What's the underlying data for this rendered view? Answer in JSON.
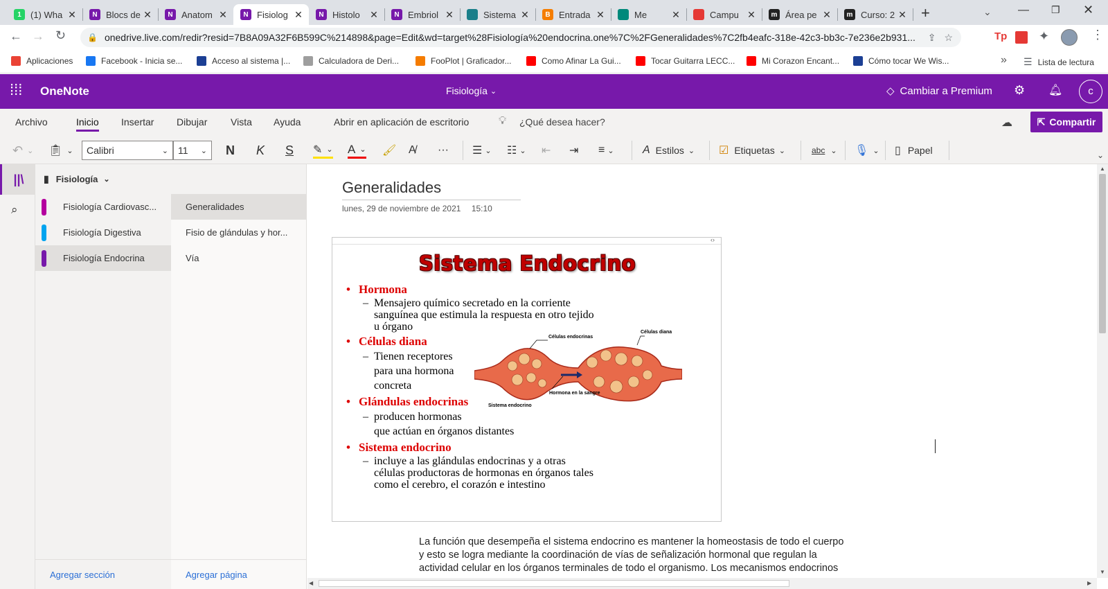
{
  "browser": {
    "tabs": [
      {
        "title": "(1) Wha",
        "icon": "whatsapp-icon",
        "color": "#25d366",
        "glyph": "1"
      },
      {
        "title": "Blocs de",
        "icon": "onenote-icon",
        "color": "#7719aa",
        "glyph": "N"
      },
      {
        "title": "Anatom",
        "icon": "onenote-icon",
        "color": "#7719aa",
        "glyph": "N"
      },
      {
        "title": "Fisiolog",
        "icon": "onenote-icon",
        "color": "#7719aa",
        "glyph": "N"
      },
      {
        "title": "Histolo",
        "icon": "onenote-icon",
        "color": "#7719aa",
        "glyph": "N"
      },
      {
        "title": "Embriol",
        "icon": "onenote-icon",
        "color": "#7719aa",
        "glyph": "N"
      },
      {
        "title": "Sistema",
        "icon": "slide-icon",
        "color": "#1a7f8a",
        "glyph": ""
      },
      {
        "title": "Entrada",
        "icon": "blogger-icon",
        "color": "#f57d00",
        "glyph": "B"
      },
      {
        "title": "Me",
        "icon": "meet-icon",
        "color": "#00897b",
        "glyph": ""
      },
      {
        "title": "Campu",
        "icon": "campus-icon",
        "color": "#e53935",
        "glyph": ""
      },
      {
        "title": "Área pe",
        "icon": "moodle-icon",
        "color": "#222222",
        "glyph": "m"
      },
      {
        "title": "Curso: 2",
        "icon": "moodle-icon",
        "color": "#222222",
        "glyph": "m"
      }
    ],
    "new_tab": "+",
    "url": "onedrive.live.com/redir?resid=7B8A09A32F6B599C%214898&page=Edit&wd=target%28Fisiología%20endocrina.one%7C%2FGeneralidades%7C2fb4eafc-318e-42c3-bb3c-7e236e2b931...",
    "bookmarks": [
      {
        "label": "Aplicaciones",
        "icon": "apps-grid-icon",
        "color": "#ea4335"
      },
      {
        "label": "Facebook - Inicia se...",
        "icon": "facebook-icon",
        "color": "#1877f2"
      },
      {
        "label": "Acceso al sistema |...",
        "icon": "p-logo-icon",
        "color": "#1c3f94"
      },
      {
        "label": "Calculadora de Deri...",
        "icon": "calculator-icon",
        "color": "#9e9e9e"
      },
      {
        "label": "FooPlot | Graficador...",
        "icon": "fooplot-icon",
        "color": "#f57c00"
      },
      {
        "label": "Como Afinar La Gui...",
        "icon": "youtube-icon",
        "color": "#ff0000"
      },
      {
        "label": "Tocar Guitarra LECC...",
        "icon": "youtube-icon",
        "color": "#ff0000"
      },
      {
        "label": "Mi Corazon Encant...",
        "icon": "youtube-icon",
        "color": "#ff0000"
      },
      {
        "label": "Cómo tocar We Wis...",
        "icon": "gv-icon",
        "color": "#1c3f94"
      }
    ],
    "more_bookmarks": "»",
    "reading_list": "Lista de lectura",
    "profile_initial": "C"
  },
  "onenote": {
    "app_name": "OneNote",
    "notebook_title": "Fisiología",
    "premium_label": "Cambiar a Premium",
    "user_initial": "c",
    "menu": [
      "Archivo",
      "Inicio",
      "Insertar",
      "Dibujar",
      "Vista",
      "Ayuda",
      "Abrir en aplicación de escritorio"
    ],
    "tell_me": "¿Qué desea hacer?",
    "share_label": "Compartir",
    "toolbar": {
      "font": "Calibri",
      "size": "11",
      "bold": "N",
      "italic": "K",
      "underline": "S",
      "more": "···",
      "styles": "Estilos",
      "tags": "Etiquetas",
      "spell": "abc",
      "paper": "Papel"
    },
    "notebook_name": "Fisiología",
    "sections": [
      {
        "label": "Fisiología Cardiovasc...",
        "color": "#b4009e"
      },
      {
        "label": "Fisiología Digestiva",
        "color": "#00a4ef"
      },
      {
        "label": "Fisiología Endocrina",
        "color": "#7719aa"
      }
    ],
    "selected_section": 2,
    "pages": [
      "Generalidades",
      "Fisio de glándulas y hor...",
      "Vía"
    ],
    "selected_page": 0,
    "add_section": "Agregar sección",
    "add_page": "Agregar página",
    "page": {
      "title": "Generalidades",
      "date": "lunes, 29 de noviembre de 2021",
      "time": "15:10",
      "slide": {
        "title": "Sistema Endocrino",
        "bullets": [
          {
            "head": "Hormona",
            "lines": [
              "Mensajero químico secretado en la corriente",
              "sanguínea que estimula la respuesta en otro tejido",
              "u órgano"
            ]
          },
          {
            "head": "Células diana",
            "lines": [
              "Tienen receptores",
              "para una hormona",
              "concreta"
            ]
          },
          {
            "head": "Glándulas endocrinas",
            "lines": [
              "producen hormonas",
              "que actúan en órganos distantes"
            ]
          },
          {
            "head": "Sistema endocrino",
            "lines": [
              "incluye a las glándulas endocrinas y a otras",
              "células productoras de hormonas en órganos tales",
              "como el cerebro, el corazón e intestino"
            ]
          }
        ],
        "diagram_labels": {
          "endocrine_cells": "Células endocrinas",
          "target_cells": "Células diana",
          "hormone_blood": "Hormona en la sangre",
          "system": "Sistema endocrino"
        }
      },
      "body": [
        "La función que desempeña el sistema endocrino es mantener la homeostasis de todo el cuerpo",
        "y esto se logra mediante la coordinación de vías de señalización hormonal que regulan la",
        "actividad celular en los órganos terminales de todo el organismo. Los mecanismos endocrinos"
      ]
    }
  },
  "colors": {
    "brand": "#7719aa",
    "chrome_bg": "#dee1e6",
    "accent_red": "#dd0000"
  }
}
